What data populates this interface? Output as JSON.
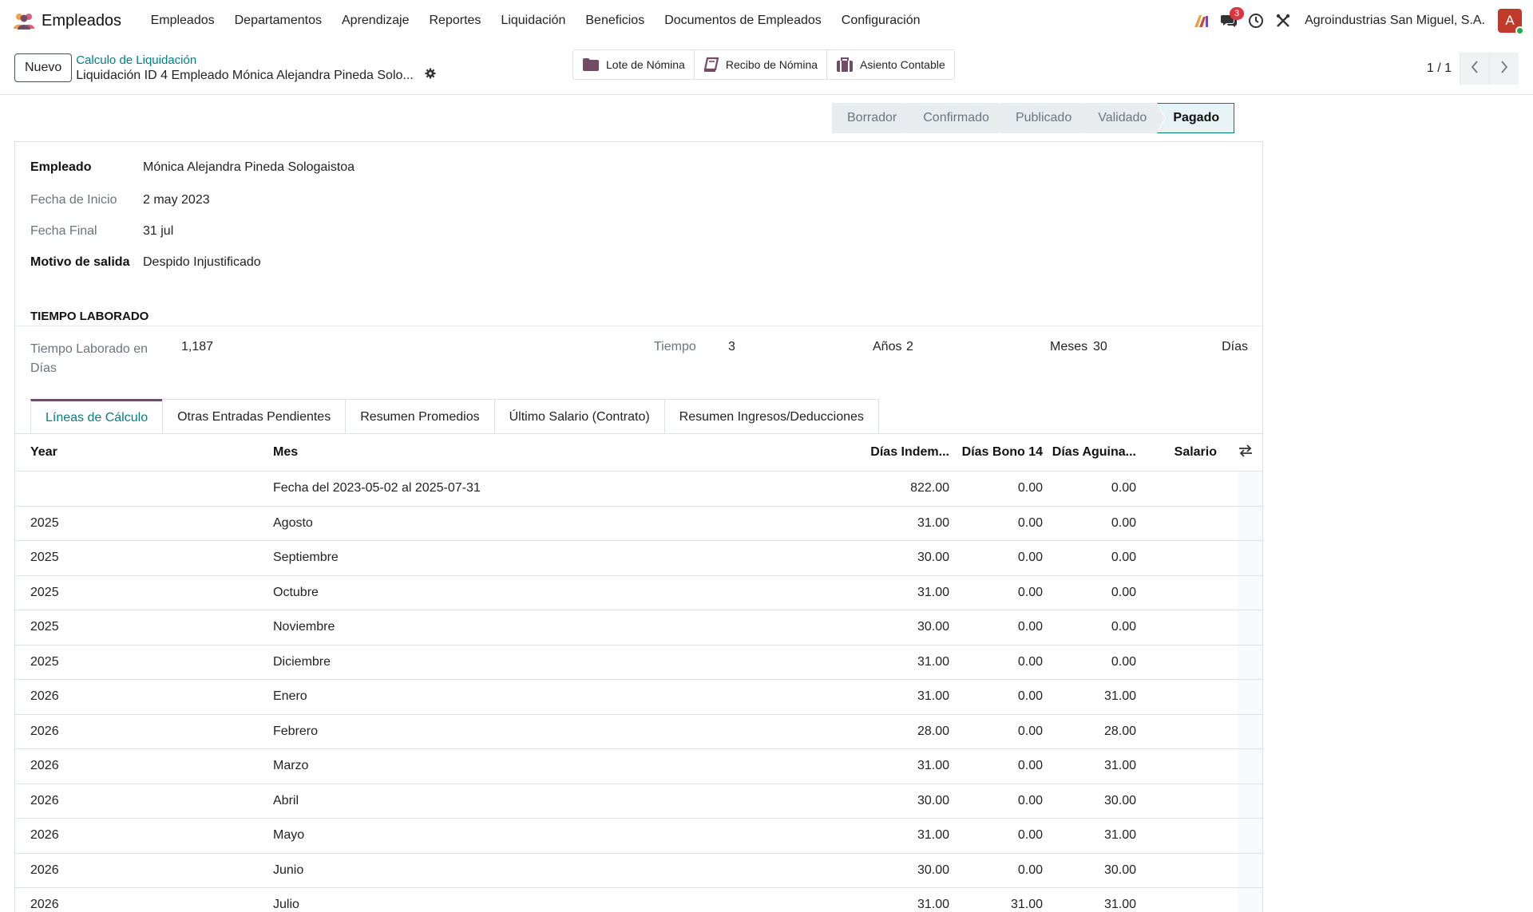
{
  "navbar": {
    "app_name": "Empleados",
    "menu": [
      "Empleados",
      "Departamentos",
      "Aprendizaje",
      "Reportes",
      "Liquidación",
      "Beneficios",
      "Documentos de Empleados",
      "Configuración"
    ],
    "messages_badge": "3",
    "company": "Agroindustrias San Miguel, S.A.",
    "avatar_letter": "A",
    "colors": {
      "brand": "#714b67",
      "accent": "#017e84",
      "avatar": "#c0392b",
      "badge": "#d9363e"
    }
  },
  "control": {
    "new_button": "Nuevo",
    "breadcrumb_parent": "Calculo de Liquidación",
    "breadcrumb_current": "Liquidación ID 4 Empleado Mónica Alejandra Pineda Solo...",
    "smart_buttons": [
      {
        "label": "Lote de Nómina",
        "icon": "folder-icon"
      },
      {
        "label": "Recibo de Nómina",
        "icon": "book-icon"
      },
      {
        "label": "Asiento Contable",
        "icon": "briefcase-icon"
      }
    ],
    "pager_value": "1 / 1"
  },
  "status": {
    "steps": [
      "Borrador",
      "Confirmado",
      "Publicado",
      "Validado",
      "Pagado"
    ],
    "active": "Pagado"
  },
  "form": {
    "empleado_label": "Empleado",
    "empleado_value": "Mónica Alejandra Pineda Sologaistoa",
    "fecha_inicio_label": "Fecha de Inicio",
    "fecha_inicio_value": "2 may 2023",
    "fecha_final_label": "Fecha Final",
    "fecha_final_value": "31 jul",
    "motivo_label": "Motivo de salida",
    "motivo_value": "Despido Injustificado",
    "section_title": "TIEMPO LABORADO",
    "tiempo_dias_label": "Tiempo Laborado en Días",
    "tiempo_dias_value": "1,187",
    "tiempo_label": "Tiempo",
    "tiempo_anios_value": "3",
    "anios_label": "Años",
    "tiempo_meses_value": "2",
    "meses_label": "Meses",
    "tiempo_dias_rest_value": "30",
    "dias_label": "Días"
  },
  "tabs": [
    "Líneas de Cálculo",
    "Otras Entradas Pendientes",
    "Resumen Promedios",
    "Último Salario (Contrato)",
    "Resumen Ingresos/Deducciones"
  ],
  "table": {
    "headers": {
      "year": "Year",
      "mes": "Mes",
      "indem": "Días Indem...",
      "bono": "Días Bono 14",
      "agui": "Días Aguina...",
      "salario": "Salario"
    },
    "rows": [
      {
        "year": "",
        "mes": "Fecha del 2023-05-02 al 2025-07-31",
        "indem": "822.00",
        "bono": "0.00",
        "agui": "0.00"
      },
      {
        "year": "2025",
        "mes": "Agosto",
        "indem": "31.00",
        "bono": "0.00",
        "agui": "0.00"
      },
      {
        "year": "2025",
        "mes": "Septiembre",
        "indem": "30.00",
        "bono": "0.00",
        "agui": "0.00"
      },
      {
        "year": "2025",
        "mes": "Octubre",
        "indem": "31.00",
        "bono": "0.00",
        "agui": "0.00"
      },
      {
        "year": "2025",
        "mes": "Noviembre",
        "indem": "30.00",
        "bono": "0.00",
        "agui": "0.00"
      },
      {
        "year": "2025",
        "mes": "Diciembre",
        "indem": "31.00",
        "bono": "0.00",
        "agui": "0.00"
      },
      {
        "year": "2026",
        "mes": "Enero",
        "indem": "31.00",
        "bono": "0.00",
        "agui": "31.00"
      },
      {
        "year": "2026",
        "mes": "Febrero",
        "indem": "28.00",
        "bono": "0.00",
        "agui": "28.00"
      },
      {
        "year": "2026",
        "mes": "Marzo",
        "indem": "31.00",
        "bono": "0.00",
        "agui": "31.00"
      },
      {
        "year": "2026",
        "mes": "Abril",
        "indem": "30.00",
        "bono": "0.00",
        "agui": "30.00"
      },
      {
        "year": "2026",
        "mes": "Mayo",
        "indem": "31.00",
        "bono": "0.00",
        "agui": "31.00"
      },
      {
        "year": "2026",
        "mes": "Junio",
        "indem": "30.00",
        "bono": "0.00",
        "agui": "30.00"
      },
      {
        "year": "2026",
        "mes": "Julio",
        "indem": "31.00",
        "bono": "31.00",
        "agui": "31.00"
      }
    ]
  }
}
